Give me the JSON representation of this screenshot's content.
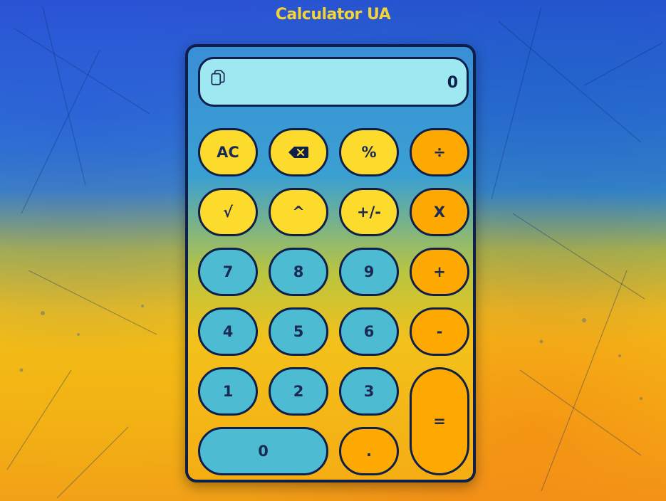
{
  "app": {
    "title": "Calculator UA"
  },
  "display": {
    "value": "0",
    "copy_icon": "copy-icon"
  },
  "buttons": {
    "ac": "AC",
    "backspace_icon": "backspace-icon",
    "percent": "%",
    "divide": "÷",
    "sqrt": "√",
    "power": "^",
    "plus_minus": "+/-",
    "multiply": "X",
    "seven": "7",
    "eight": "8",
    "nine": "9",
    "plus": "+",
    "four": "4",
    "five": "5",
    "six": "6",
    "minus": "-",
    "one": "1",
    "two": "2",
    "three": "3",
    "equals": "=",
    "zero": "0",
    "dot": "."
  },
  "colors": {
    "function_key": "#fddb2c",
    "operator_key": "#fea901",
    "digit_key": "#4dbcd3",
    "display_bg": "#9ee8f2",
    "border": "#0d1f4a",
    "title": "#f3d23a"
  }
}
